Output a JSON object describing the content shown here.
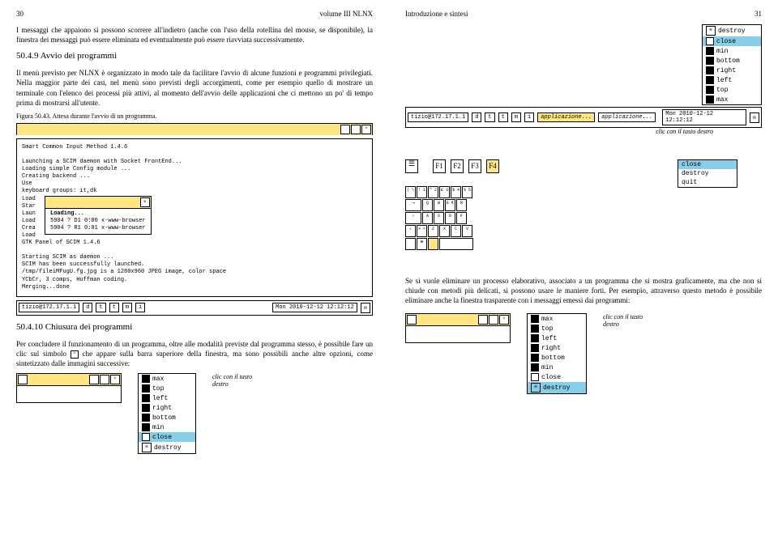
{
  "left": {
    "pgnum": "30",
    "header_right": "volume III    NLNX",
    "p1": "I messaggi che appaiono si possono scorrere all'indietro (anche con l'uso della rotellina del mouse, se disponibile), la finestra dei messaggi può essere eliminata ed eventualmente può essere riavviata successivamente.",
    "sec1": "50.4.9 Avvio dei programmi",
    "p2": "Il menù previsto per NLNX è organizzato in modo tale da facilitare l'avvio di alcune funzioni e programmi privilegiati. Nella maggior parte dei casi, nel menù sono previsti degli accorgimenti, come per esempio quello di mostrare un terminale con l'elenco dei processi più attivi, al momento dell'avvio delle applicazioni che ci mettono un po' di tempo prima di mostrarsi all'utente.",
    "cap1": "Figura 50.43. Attesa durante l'avvio di un programma.",
    "term": {
      "l1": "Smart Common Input Method 1.4.6",
      "l2": "Launching a SCIM daemon with Socket FrontEnd...",
      "l3": "Loading simple Config module ...",
      "l4": "Creating backend ...",
      "l5": "Use",
      "l6": "keyboard groups: it,dk",
      "l7": "Load",
      "l8": "Star",
      "l9": "Laun",
      "l10": "Load",
      "l11": "Crea",
      "l12": "Load",
      "l13": "GTK Panel of SCIM 1.4.6",
      "l14": "Starting SCIM as daemon ...",
      "l15": "SCIM has been successfully launched.",
      "l16": "/tmp/fileiMFugU.fg.jpg is a 1280x960 JPEG image, color space",
      "l17": "YCbCr, 3 comps, Huffman coding.",
      "l18": "  Merging...done",
      "inner1": "Loading...",
      "inner2": " 5904 ?        D1     0:00 x-www-browser",
      "inner3": " 5904 ?        R1     0:01 x-www-browser"
    },
    "taskbar": {
      "host": "tizio@172.17.1.1",
      "b1": "d",
      "b2": "t",
      "b3": "t",
      "b4": "m",
      "b5": "i",
      "time": "Mon 2010-12-12 12:12:12"
    },
    "sec2": "50.4.10 Chiusura dei programmi",
    "p3a": "Per concludere il funzionamento di un programma, oltre alle modalità previste dal programma stesso, è possibile fare un clic sul simbolo ",
    "p3b": " che appare sulla barra superiore della finestra, ma sono possibili anche altre opzioni, come sintetizzato dalle immagini successive:",
    "menu1": {
      "i1": "max",
      "i2": "top",
      "i3": "left",
      "i4": "right",
      "i5": "bottom",
      "i6": "min",
      "i7": "close",
      "i8": "destroy"
    },
    "note1": "clic con il tasto destro"
  },
  "right": {
    "header_left": "Introduzione e sintesi",
    "pgnum": "31",
    "menu_top": {
      "i1": "destroy",
      "i2": "close",
      "i3": "min",
      "i4": "bottom",
      "i5": "right",
      "i6": "left",
      "i7": "top",
      "i8": "max"
    },
    "taskbar2": {
      "host": "tizio@172.17.1.1",
      "b1": "d",
      "b2": "t",
      "b3": "t",
      "b4": "m",
      "b5": "i",
      "app1": "applicazione...",
      "app2": "applicazione...",
      "time": "Mon 2010-12-12 12:12:12"
    },
    "note2": "clic con il tasto destro",
    "menu_mid": {
      "i1": "close",
      "i2": "destroy",
      "i3": "quit"
    },
    "fkeys": {
      "f1": "F1",
      "f2": "F2",
      "f3": "F3",
      "f4": "F4"
    },
    "p4": "Se si vuole eliminare un processo elaborativo, associato a un programma che si mostra graficamente, ma che non si chiude con metodi più delicati, si possono usare le maniere forti. Per esempio, attraverso questo metodo è possibile eliminare anche la finestra trasparente con i messaggi emessi dai programmi:",
    "menu_bot": {
      "i1": "max",
      "i2": "top",
      "i3": "left",
      "i4": "right",
      "i5": "bottom",
      "i6": "min",
      "i7": "close",
      "i8": "destroy"
    },
    "note3": "clic con il tasto destro"
  }
}
